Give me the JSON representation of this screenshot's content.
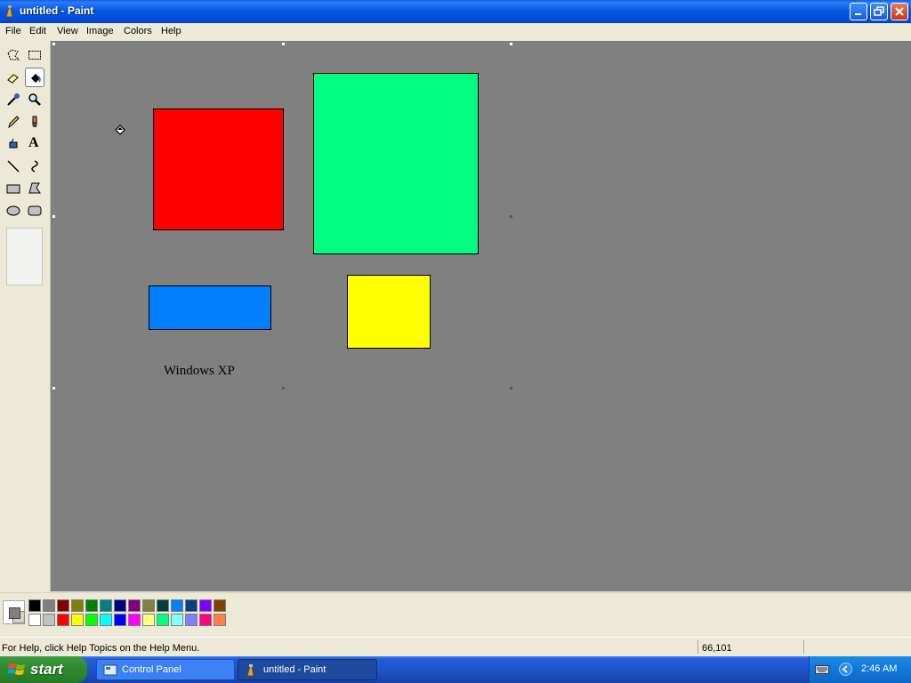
{
  "window": {
    "title": "untitled - Paint",
    "controls": [
      "minimize",
      "maximize",
      "close"
    ]
  },
  "menu": {
    "items": [
      "File",
      "Edit",
      "View",
      "Image",
      "Colors",
      "Help"
    ]
  },
  "toolbox": {
    "tools": [
      {
        "name": "free-form-select-icon"
      },
      {
        "name": "rect-select-icon"
      },
      {
        "name": "eraser-icon"
      },
      {
        "name": "fill-bucket-icon",
        "active": true
      },
      {
        "name": "color-picker-icon"
      },
      {
        "name": "magnifier-icon"
      },
      {
        "name": "pencil-icon"
      },
      {
        "name": "brush-icon"
      },
      {
        "name": "airbrush-icon"
      },
      {
        "name": "text-icon"
      },
      {
        "name": "line-icon"
      },
      {
        "name": "curve-icon"
      },
      {
        "name": "rectangle-icon"
      },
      {
        "name": "polygon-icon"
      },
      {
        "name": "ellipse-icon"
      },
      {
        "name": "rounded-rect-icon"
      }
    ],
    "text_tool_glyph": "A"
  },
  "canvas": {
    "background": "#808080",
    "shapes": [
      {
        "name": "red-rectangle",
        "fill": "#ff0000"
      },
      {
        "name": "green-rectangle",
        "fill": "#00ff80"
      },
      {
        "name": "blue-rectangle",
        "fill": "#0080ff"
      },
      {
        "name": "yellow-rectangle",
        "fill": "#ffff00"
      }
    ],
    "text": "Windows XP"
  },
  "palette": {
    "foreground": "#808080",
    "background": "#d4d0c8",
    "row1": [
      "#000000",
      "#808080",
      "#800000",
      "#808000",
      "#008000",
      "#008080",
      "#000080",
      "#800080",
      "#808040",
      "#004040",
      "#0080ff",
      "#004080",
      "#8000ff",
      "#804000"
    ],
    "row2": [
      "#ffffff",
      "#c0c0c0",
      "#ff0000",
      "#ffff00",
      "#00ff00",
      "#00ffff",
      "#0000ff",
      "#ff00ff",
      "#ffff80",
      "#00ff80",
      "#80ffff",
      "#8080ff",
      "#ff0080",
      "#ff8040"
    ]
  },
  "statusbar": {
    "help_text": "For Help, click Help Topics on the Help Menu.",
    "coords": "66,101"
  },
  "taskbar": {
    "start_label": "start",
    "buttons": [
      {
        "label": "Control Panel",
        "active": false
      },
      {
        "label": "untitled - Paint",
        "active": true
      }
    ],
    "clock": "2:46 AM"
  }
}
